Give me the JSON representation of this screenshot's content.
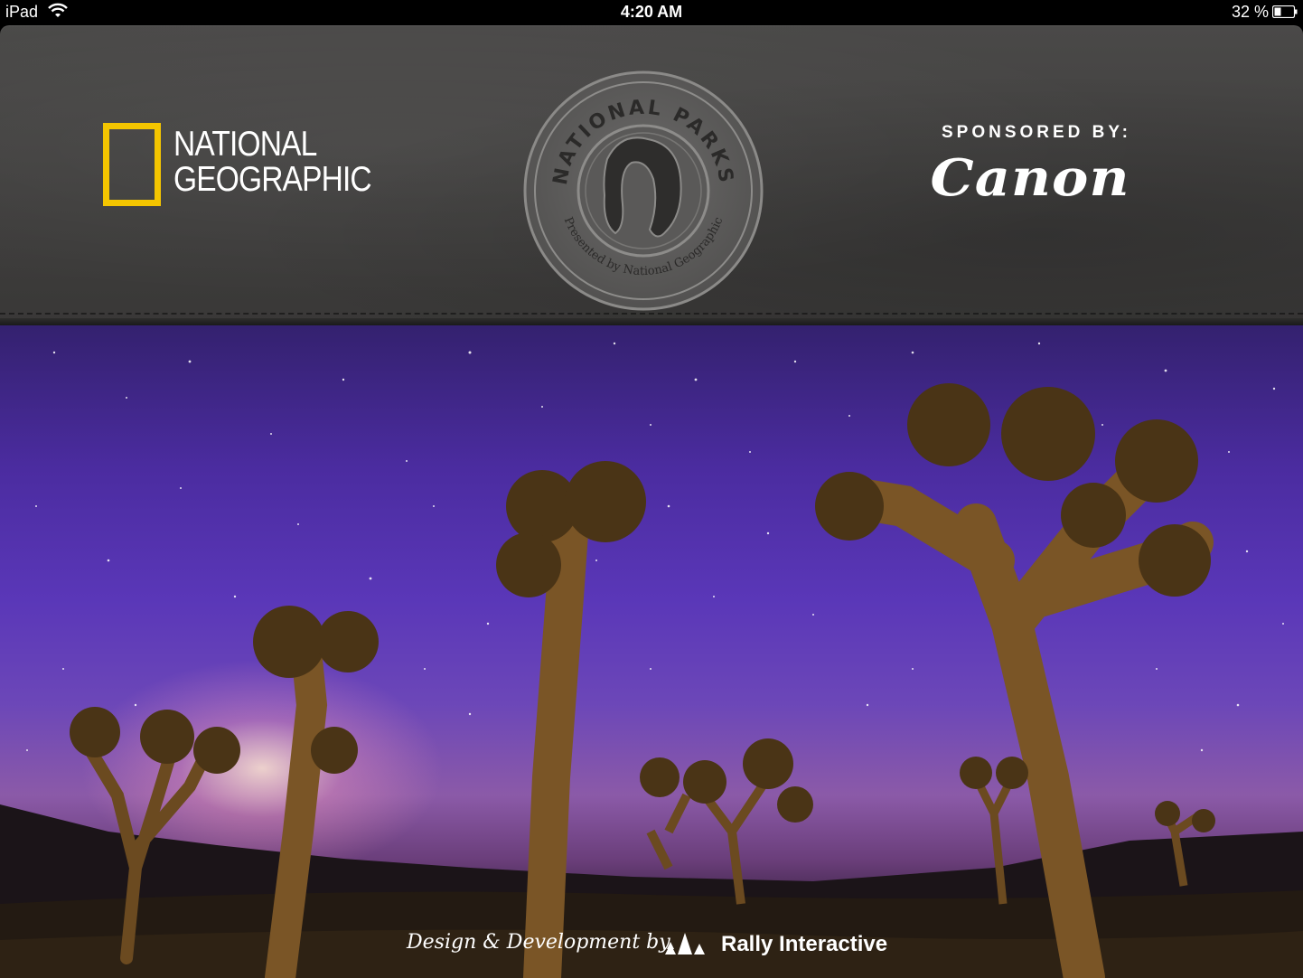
{
  "status_bar": {
    "device": "iPad",
    "time": "4:20 AM",
    "battery": "32 %"
  },
  "header": {
    "ng_logo": {
      "line1": "NATIONAL",
      "line2": "GEOGRAPHIC",
      "accent": "#f4c500"
    },
    "seal": {
      "top_text": "NATIONAL PARKS",
      "bottom_text": "Presented by National Geographic"
    },
    "sponsor": {
      "label": "SPONSORED BY:",
      "brand": "Canon"
    }
  },
  "footer": {
    "credit_prefix": "Design & Development by",
    "credit_company": "Rally Interactive"
  },
  "colors": {
    "leather": "#403f3e",
    "sky": "#5a37b8"
  }
}
